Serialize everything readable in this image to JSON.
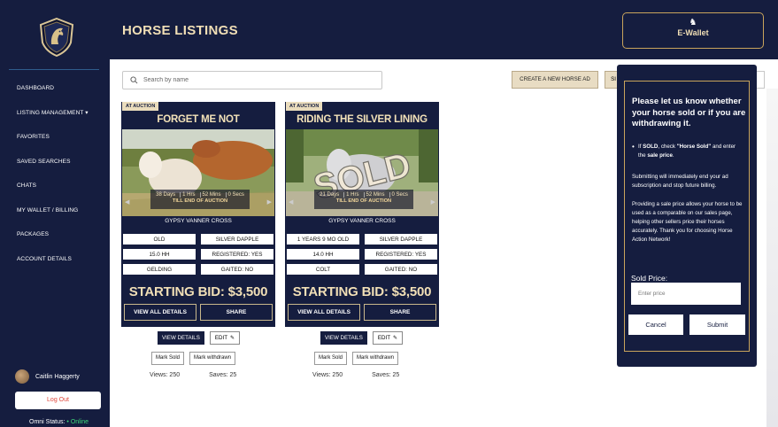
{
  "app": {
    "page_title": "HORSE LISTINGS"
  },
  "wallet": {
    "label": "E-Wallet",
    "icon": "horse-head-icon"
  },
  "sidebar": {
    "items": [
      {
        "label": "DASHBOARD"
      },
      {
        "label": "LISTING MANAGEMENT ▾"
      },
      {
        "label": "FAVORITES"
      },
      {
        "label": "SAVED SEARCHES"
      },
      {
        "label": "CHATS"
      },
      {
        "label": "MY WALLET / BILLING"
      },
      {
        "label": "PACKAGES"
      },
      {
        "label": "ACCOUNT DETAILS"
      }
    ],
    "user_name": "Caitlin Haggerty",
    "logout_label": "Log Out",
    "status_label": "Omni Status:",
    "status_value": "• Online"
  },
  "toolbar": {
    "search_placeholder": "Search by name",
    "create_label": "CREATE A NEW HORSE AD",
    "second_label": "SI"
  },
  "listings": [
    {
      "badge": "AT AUCTION",
      "name": "FORGET ME NOT",
      "timer": {
        "days": "38 Days",
        "hrs": "1 Hrs",
        "mins": "52 Mins",
        "secs": "0 Secs",
        "sub": "TILL END OF AUCTION"
      },
      "breed": "GYPSY VANNER CROSS",
      "attrs": [
        "OLD",
        "SILVER DAPPLE",
        "15.0 HH",
        "REGISTERED: YES",
        "GELDING",
        "GAITED: NO"
      ],
      "bid": "STARTING BID: $3,500",
      "view_all": "VIEW ALL DETAILS",
      "share": "SHARE",
      "view_details": "VIEW DETAILS",
      "edit": "EDIT",
      "mark_sold": "Mark Sold",
      "mark_withdrawn": "Mark withdrawn",
      "views": "Views: 250",
      "saves": "Saves: 25"
    },
    {
      "badge": "AT AUCTION",
      "name": "RIDING THE SILVER LINING",
      "sold_overlay": "SOLD",
      "timer": {
        "days": "21 Days",
        "hrs": "1 Hrs",
        "mins": "52 Mins",
        "secs": "0 Secs",
        "sub": "TILL END OF AUCTION"
      },
      "breed": "GYPSY VANNER CROSS",
      "attrs": [
        "1 YEARS 9 MO OLD",
        "SILVER DAPPLE",
        "14.0 HH",
        "REGISTERED: YES",
        "COLT",
        "GAITED: NO"
      ],
      "bid": "STARTING BID: $3,500",
      "view_all": "VIEW ALL DETAILS",
      "share": "SHARE",
      "view_details": "VIEW DETAILS",
      "edit": "EDIT",
      "mark_sold": "Mark Sold",
      "mark_withdrawn": "Mark withdrawn",
      "views": "Views: 250",
      "saves": "Saves: 25"
    }
  ],
  "modal": {
    "title": "Please let us know whether your horse sold or if you are withdrawing it.",
    "bullet_a": "If ",
    "bullet_b": "SOLD",
    "bullet_c": ", check ",
    "bullet_d": "\"Horse Sold\"",
    "bullet_e": " and enter the ",
    "bullet_f": "sale price",
    "bullet_g": ".",
    "para1": "Submitting will immediately end your ad subscription and stop future billing.",
    "para2": "Providing a sale price allows your horse to be used as a comparable on our sales page, helping other sellers price their horses accurately. Thank you for choosing Horse Action Network!",
    "price_label": "Sold Price:",
    "price_placeholder": "Enter price",
    "cancel": "Cancel",
    "submit": "Submit"
  },
  "colors": {
    "navy": "#151d3f",
    "gold": "#c9a45c",
    "cream": "#f1dfb6",
    "online": "#3fd77a",
    "logout": "#e0473b"
  }
}
